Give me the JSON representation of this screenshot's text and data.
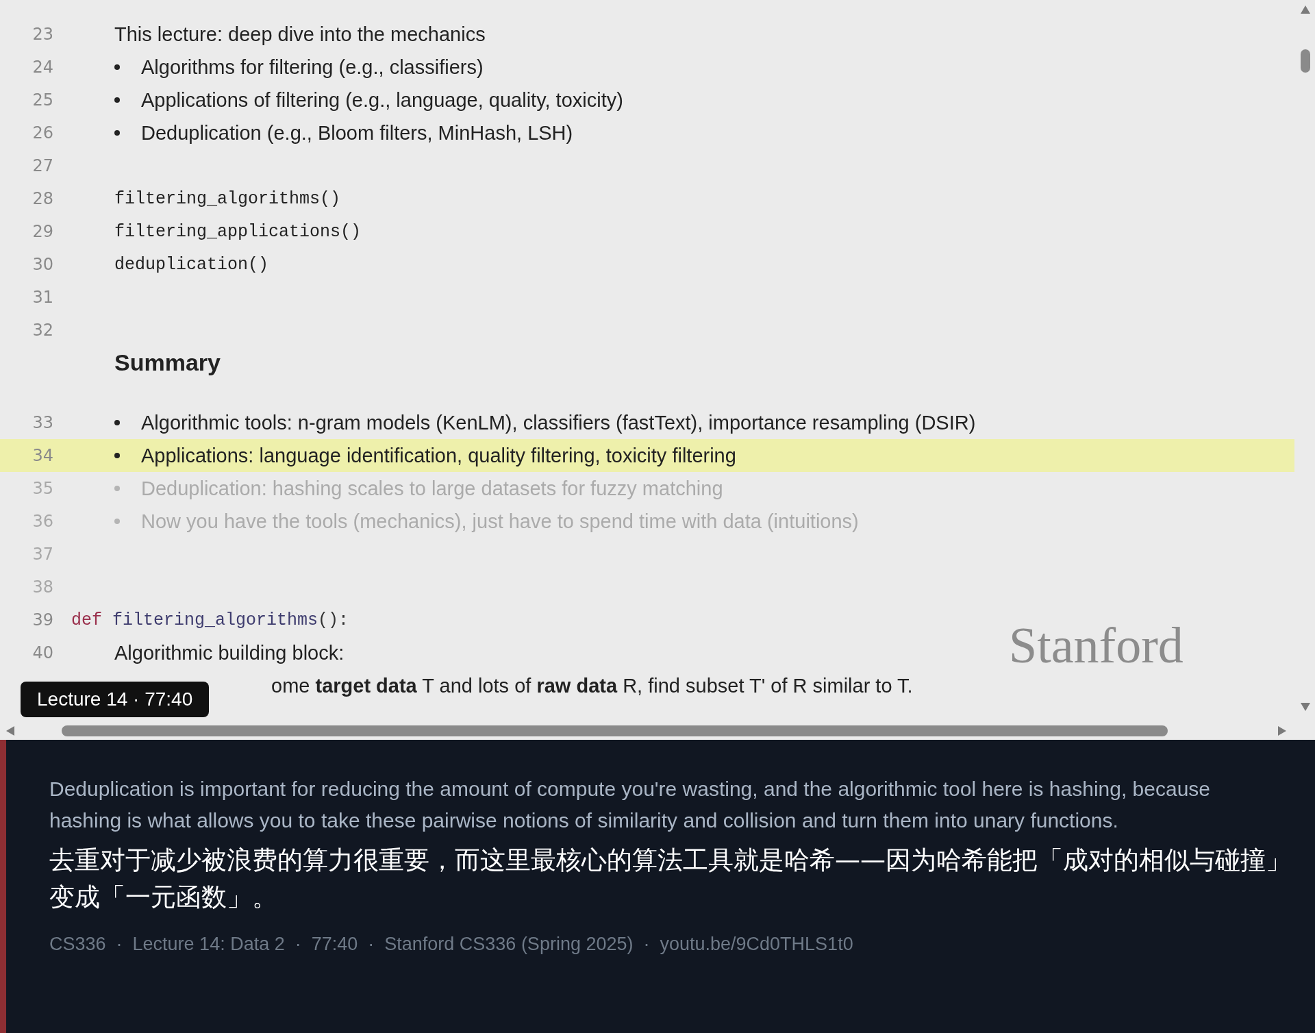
{
  "editor": {
    "lines": [
      {
        "number": "23",
        "kind": "text",
        "text": "This lecture: deep dive into the mechanics",
        "faded": false,
        "highlighted": false
      },
      {
        "number": "24",
        "kind": "bullet",
        "text": "Algorithms for filtering (e.g., classifiers)",
        "faded": false,
        "highlighted": false
      },
      {
        "number": "25",
        "kind": "bullet",
        "text": "Applications of filtering (e.g., language, quality, toxicity)",
        "faded": false,
        "highlighted": false
      },
      {
        "number": "26",
        "kind": "bullet",
        "text": "Deduplication (e.g., Bloom filters, MinHash, LSH)",
        "faded": false,
        "highlighted": false
      },
      {
        "number": "27",
        "kind": "blank",
        "faded": false,
        "highlighted": false
      },
      {
        "number": "28",
        "kind": "code",
        "text": "filtering_algorithms()",
        "faded": false,
        "highlighted": false
      },
      {
        "number": "29",
        "kind": "code",
        "text": "filtering_applications()",
        "faded": false,
        "highlighted": false
      },
      {
        "number": "30",
        "kind": "code",
        "text": "deduplication()",
        "faded": false,
        "highlighted": false
      },
      {
        "number": "31",
        "kind": "blank",
        "faded": false,
        "highlighted": false
      },
      {
        "number": "32",
        "kind": "blank",
        "faded": false,
        "highlighted": false
      },
      {
        "kind": "heading",
        "text": "Summary",
        "faded": false,
        "highlighted": false
      },
      {
        "number": "33",
        "kind": "bullet",
        "text": "Algorithmic tools: n-gram models (KenLM), classifiers (fastText), importance resampling (DSIR)",
        "faded": false,
        "highlighted": false
      },
      {
        "number": "34",
        "kind": "bullet",
        "text": "Applications: language identification, quality filtering, toxicity filtering",
        "faded": false,
        "highlighted": true
      },
      {
        "number": "35",
        "kind": "bullet",
        "text": "Deduplication: hashing scales to large datasets for fuzzy matching",
        "faded": true,
        "highlighted": false
      },
      {
        "number": "36",
        "kind": "bullet",
        "text": "Now you have the tools (mechanics), just have to spend time with data (intuitions)",
        "faded": true,
        "highlighted": false
      },
      {
        "number": "37",
        "kind": "blank",
        "faded": true,
        "highlighted": false
      },
      {
        "number": "38",
        "kind": "blank",
        "faded": true,
        "highlighted": false
      },
      {
        "number": "39",
        "kind": "def",
        "keyword": "def",
        "name": "filtering_algorithms",
        "text": "():",
        "faded": false,
        "highlighted": false
      },
      {
        "number": "40",
        "kind": "text",
        "text": "Algorithmic building block:",
        "faded": false,
        "highlighted": false
      },
      {
        "kind": "covered",
        "text": "ome **target data** T and lots of **raw data** R, find subset T' of R similar to T.",
        "faded": false,
        "highlighted": false
      }
    ]
  },
  "logo": "Stanford",
  "badge": "Lecture 14 · 77:40",
  "captions": {
    "english": "Deduplication is important for reducing the amount of compute you're wasting, and the algorithmic tool here is hashing, because hashing is what allows you to take these pairwise notions of similarity and collision and turn them into unary functions.",
    "chinese": "去重对于减少被浪费的算力很重要，而这里最核心的算法工具就是哈希——因为哈希能把「成对的相似与碰撞」变成「一元函数」。",
    "footer": "CS336  ·  Lecture 14: Data 2  ·  77:40  ·  Stanford CS336 (Spring 2025)  ·  youtu.be/9Cd0THLS1t0"
  }
}
